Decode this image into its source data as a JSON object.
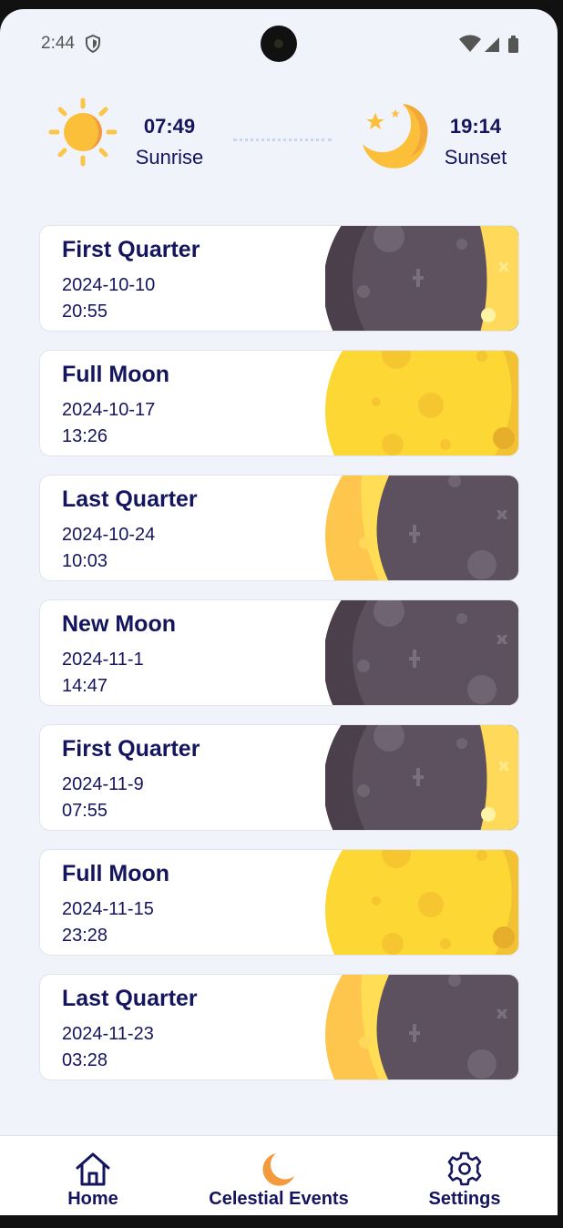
{
  "status_bar": {
    "time": "2:44"
  },
  "sun": {
    "sunrise_time": "07:49",
    "sunrise_label": "Sunrise",
    "sunset_time": "19:14",
    "sunset_label": "Sunset"
  },
  "phases": [
    {
      "name": "First Quarter",
      "date": "2024-10-10",
      "time": "20:55",
      "icon": "first-quarter-moon"
    },
    {
      "name": "Full Moon",
      "date": "2024-10-17",
      "time": "13:26",
      "icon": "full-moon"
    },
    {
      "name": "Last Quarter",
      "date": "2024-10-24",
      "time": "10:03",
      "icon": "last-quarter-moon"
    },
    {
      "name": "New Moon",
      "date": "2024-11-1",
      "time": "14:47",
      "icon": "new-moon"
    },
    {
      "name": "First Quarter",
      "date": "2024-11-9",
      "time": "07:55",
      "icon": "first-quarter-moon"
    },
    {
      "name": "Full Moon",
      "date": "2024-11-15",
      "time": "23:28",
      "icon": "full-moon"
    },
    {
      "name": "Last Quarter",
      "date": "2024-11-23",
      "time": "03:28",
      "icon": "last-quarter-moon"
    }
  ],
  "nav": {
    "home": "Home",
    "events": "Celestial Events",
    "settings": "Settings"
  },
  "colors": {
    "text": "#14155e",
    "accent_orange": "#f39a3d",
    "moon_yellow": "#fdd835",
    "moon_dark": "#5b4f5f"
  }
}
